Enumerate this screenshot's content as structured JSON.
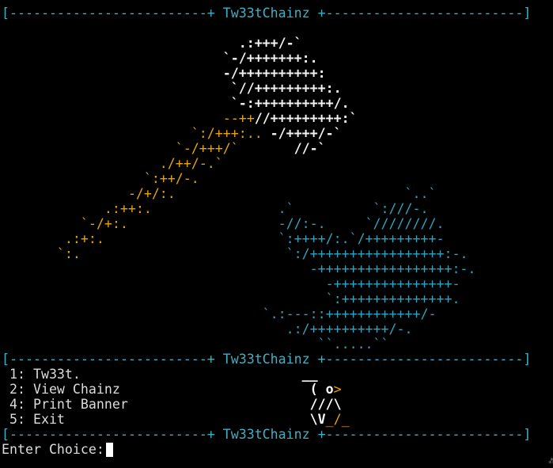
{
  "header": {
    "rule_top": "[-------------------------+ Tw33tChainz +-------------------------]"
  },
  "art": {
    "lines": [
      {
        "segments": [
          {
            "c": "white",
            "t": "                              .:+++/-`"
          }
        ]
      },
      {
        "segments": [
          {
            "c": "white",
            "t": "                            `-/+++++++:."
          }
        ]
      },
      {
        "segments": [
          {
            "c": "white",
            "t": "                            -/++++++++++:"
          }
        ]
      },
      {
        "segments": [
          {
            "c": "white",
            "t": "                             `//+++++++++:."
          }
        ]
      },
      {
        "segments": [
          {
            "c": "white",
            "t": "                             `-:++++++++++/."
          }
        ]
      },
      {
        "segments": [
          {
            "c": "orange",
            "t": "                            --++"
          },
          {
            "c": "white",
            "t": "//+++++++++:`"
          }
        ]
      },
      {
        "segments": [
          {
            "c": "orange",
            "t": "                        `:/+++:.. "
          },
          {
            "c": "white",
            "t": "-/++++/-`"
          }
        ]
      },
      {
        "segments": [
          {
            "c": "orange",
            "t": "                      `-/+++/`       "
          },
          {
            "c": "white",
            "t": "//-`"
          }
        ]
      },
      {
        "segments": [
          {
            "c": "orange",
            "t": "                    ./++/-.`"
          }
        ]
      },
      {
        "segments": [
          {
            "c": "orange",
            "t": "                  `:++/-."
          }
        ]
      },
      {
        "segments": [
          {
            "c": "orange",
            "t": "                -/+/:."
          },
          {
            "c": "cyan",
            "t": "                             `..`"
          }
        ]
      },
      {
        "segments": [
          {
            "c": "orange",
            "t": "             .:++:."
          },
          {
            "c": "cyan",
            "t": "                .`          `:///-."
          }
        ]
      },
      {
        "segments": [
          {
            "c": "orange",
            "t": "          `-/+:."
          },
          {
            "c": "cyan",
            "t": "                   -//:-.     `////////."
          }
        ]
      },
      {
        "segments": [
          {
            "c": "orange",
            "t": "        .:+:."
          },
          {
            "c": "cyan",
            "t": "                      `:++++/:.`/+++++++++-"
          }
        ]
      },
      {
        "segments": [
          {
            "c": "orange",
            "t": "       `:."
          },
          {
            "c": "cyan",
            "t": "                          `:/+++++++++++++++++:-."
          }
        ]
      },
      {
        "segments": [
          {
            "c": "cyan",
            "t": "                                       -+++++++++++++++++:-."
          }
        ]
      },
      {
        "segments": [
          {
            "c": "cyan",
            "t": "                                         -+++++++++++++++-"
          }
        ]
      },
      {
        "segments": [
          {
            "c": "cyan",
            "t": "                                         `:++++++++++++++."
          }
        ]
      },
      {
        "segments": [
          {
            "c": "cyan",
            "t": "                                 `.:---::++++++++++++/-"
          }
        ]
      },
      {
        "segments": [
          {
            "c": "cyan",
            "t": "                                    .:/++++++++++/-."
          }
        ]
      },
      {
        "segments": [
          {
            "c": "cyan",
            "t": "                                        ``.....``"
          }
        ]
      }
    ]
  },
  "menu": {
    "rule_mid": "[-------------------------+ Tw33tChainz +-------------------------]",
    "items": [
      {
        "label": " 1: Tw33t.",
        "bird": "                            __"
      },
      {
        "label": " 2: View Chainz",
        "bird": "                        ( o>"
      },
      {
        "label": " 4: Print Banner",
        "bird": "                       ///\\"
      },
      {
        "label": " 5: Exit",
        "bird": "                               \\V_/_"
      }
    ],
    "rule_bottom": "[-------------------------+ Tw33tChainz +-------------------------]"
  },
  "prompt": {
    "label": "Enter Choice:"
  },
  "colors": {
    "background": "#000000",
    "rule": "#3fb0c4",
    "art_white": "#f2f2f2",
    "art_orange": "#e5a50a",
    "art_cyan": "#2fa3bd",
    "text": "#dcdcdc"
  }
}
